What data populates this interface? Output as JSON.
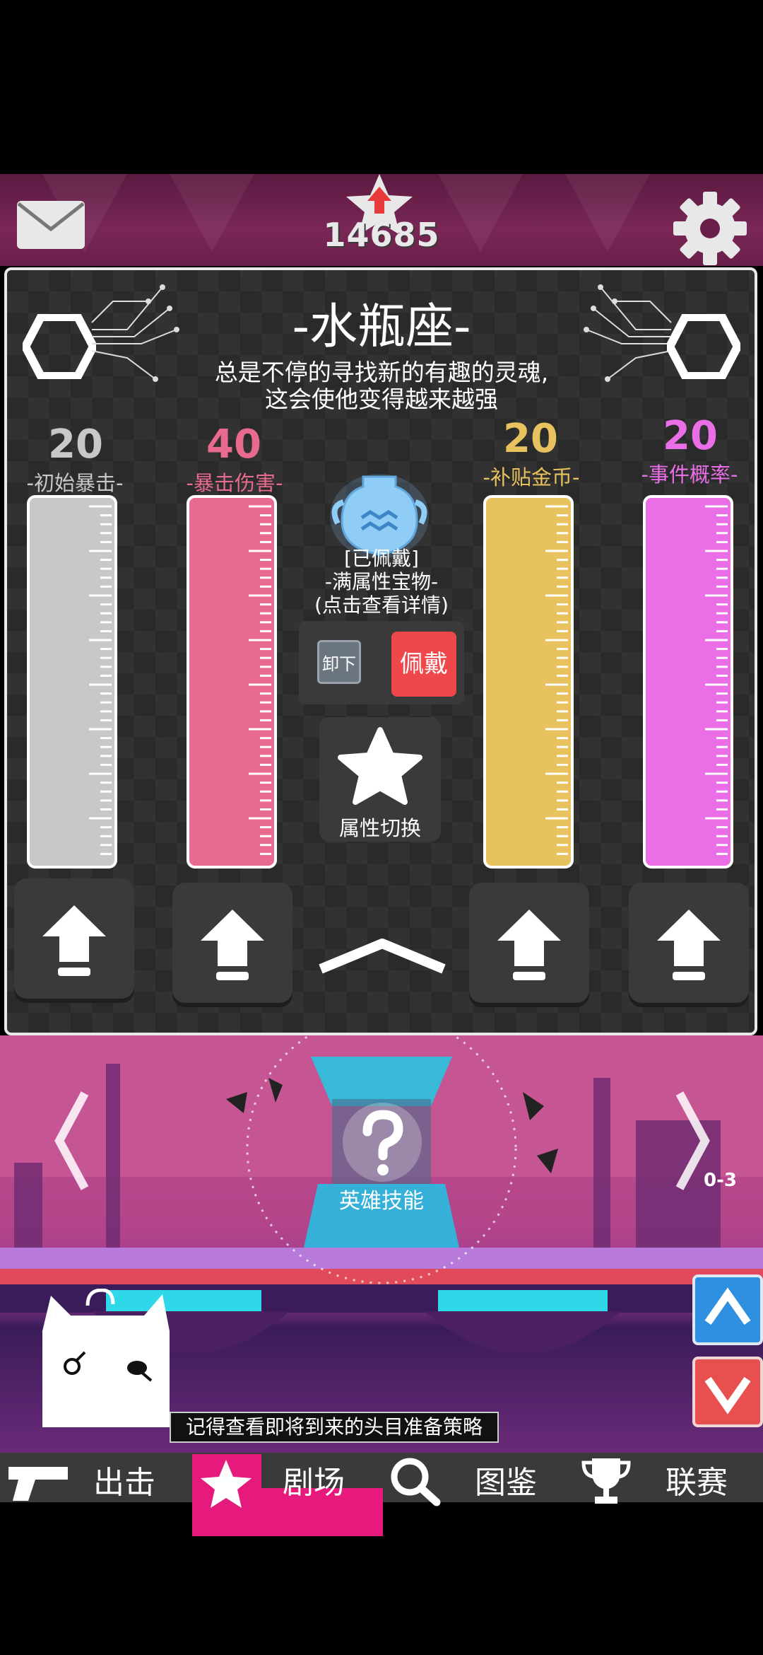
{
  "header": {
    "score": "14685",
    "icons": {
      "mail": "mail-icon",
      "settings": "gear-icon",
      "rank": "rank-up-star-icon"
    }
  },
  "panel": {
    "title": "-水瓶座-",
    "description_line1": "总是不停的寻找新的有趣的灵魂,",
    "description_line2": "这会使他变得越来越强",
    "stats": [
      {
        "value": "20",
        "label": "-初始暴击-",
        "color": "#c8c8c8"
      },
      {
        "value": "40",
        "label": "-暴击伤害-",
        "color": "#e86a8e"
      },
      {
        "value": "20",
        "label": "-补贴金币-",
        "color": "#e8c25e"
      },
      {
        "value": "20",
        "label": "-事件概率-",
        "color": "#ea6ee6"
      }
    ],
    "treasure": {
      "status": "[已佩戴]",
      "name": "-满属性宝物-",
      "hint": "(点击查看详情)",
      "unequip_label": "卸下",
      "equip_label": "佩戴"
    },
    "attr_switch_label": "属性切换"
  },
  "scene": {
    "skill_label": "英雄技能",
    "stage_code": "0-3",
    "tip": "记得查看即将到来的头目准备策略"
  },
  "nav": {
    "items": [
      {
        "label": "出击",
        "icon": "pistol-icon"
      },
      {
        "label": "剧场",
        "icon": "star-icon"
      },
      {
        "label": "图鉴",
        "icon": "magnifier-icon"
      },
      {
        "label": "联赛",
        "icon": "trophy-icon"
      }
    ]
  }
}
